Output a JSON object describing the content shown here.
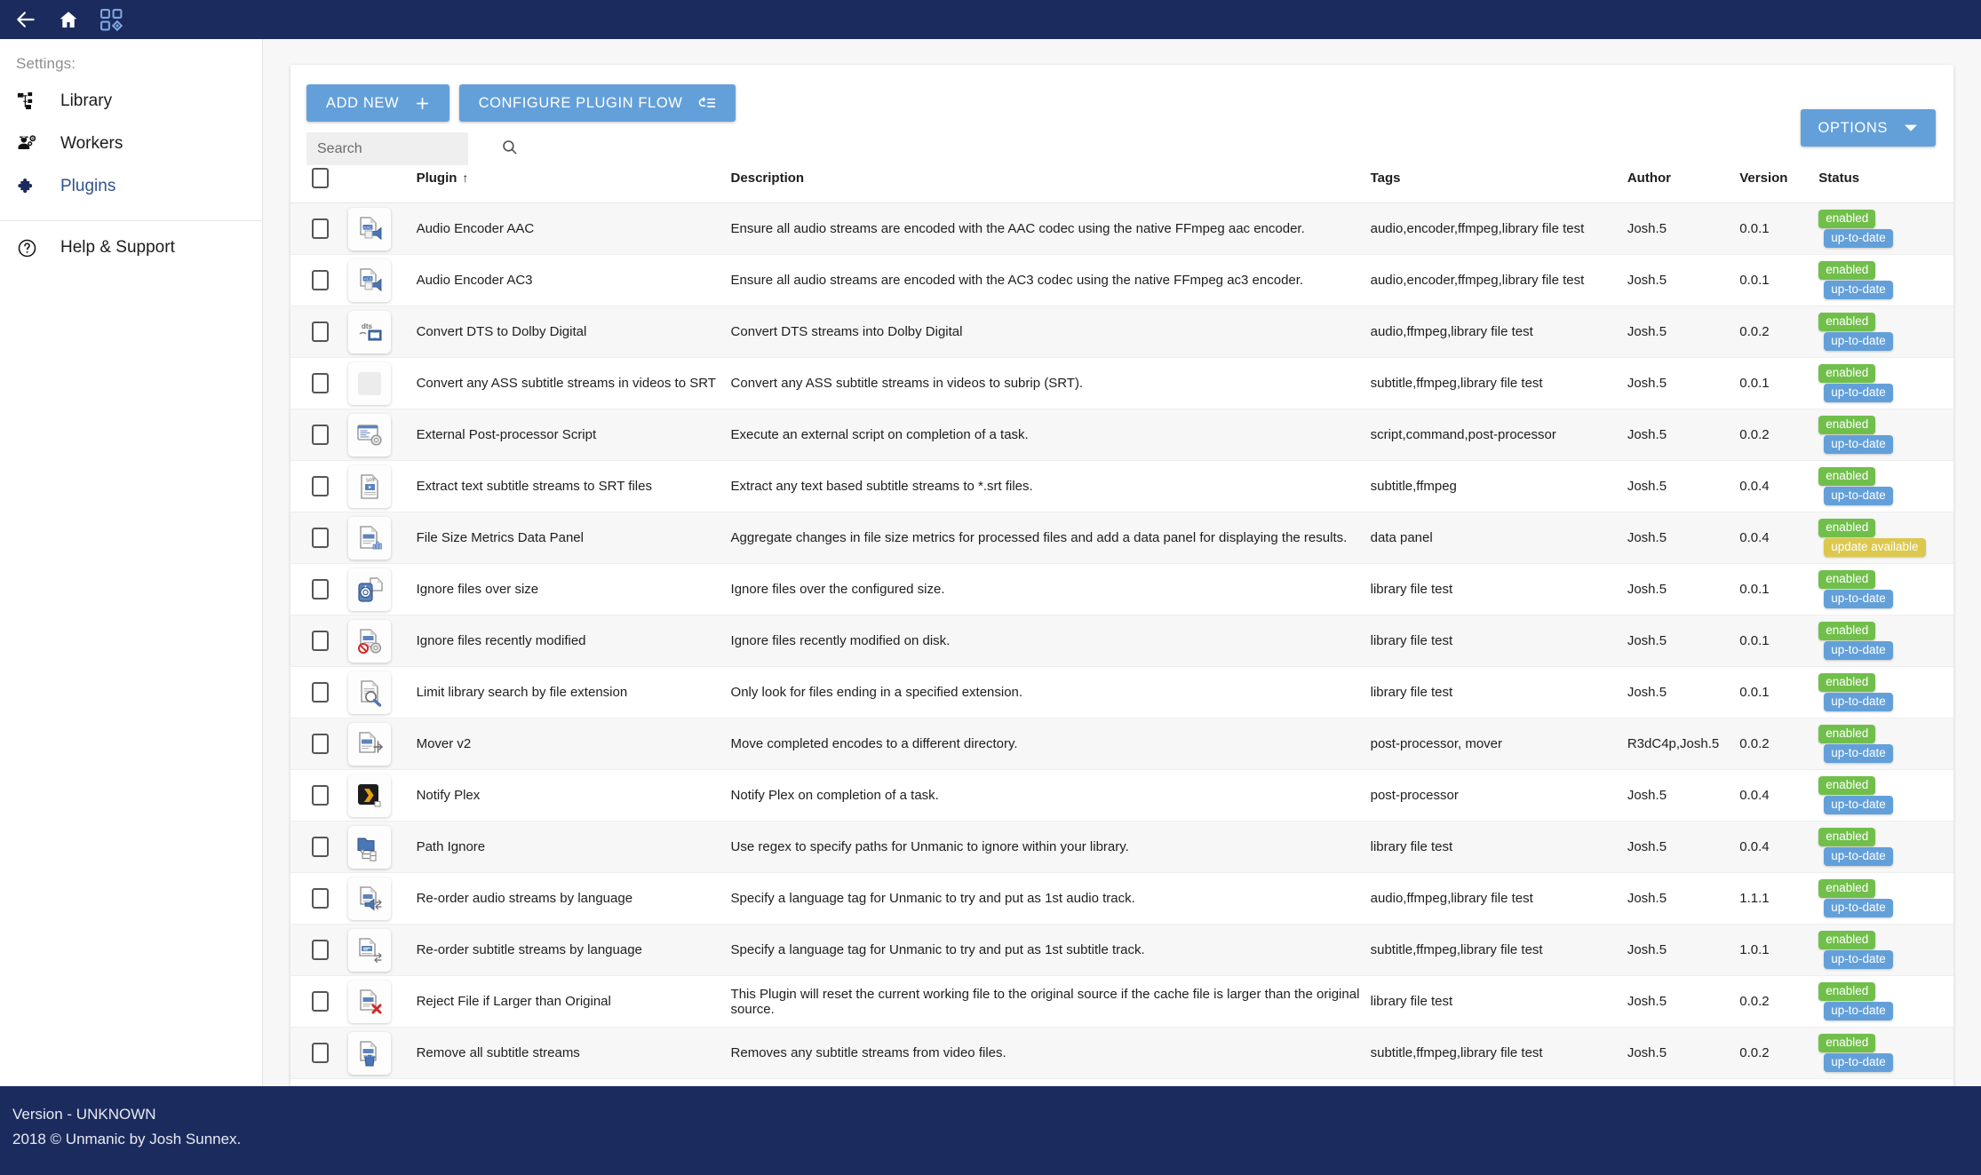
{
  "appbar": {
    "back_icon": "arrow-left-icon",
    "home_icon": "home-icon",
    "dashboard_icon": "dashboard-grid-icon"
  },
  "sidebar": {
    "heading": "Settings:",
    "items": [
      {
        "label": "Library",
        "icon": "sitemap-icon",
        "active": false
      },
      {
        "label": "Workers",
        "icon": "worker-icon",
        "active": false
      },
      {
        "label": "Plugins",
        "icon": "puzzle-icon",
        "active": true
      }
    ],
    "help": {
      "label": "Help & Support",
      "icon": "question-circle-icon"
    }
  },
  "toolbar": {
    "add_new_label": "ADD NEW",
    "add_new_icon": "plus-icon",
    "configure_flow_label": "CONFIGURE PLUGIN FLOW",
    "configure_flow_icon": "flow-icon",
    "options_label": "OPTIONS",
    "options_icon": "chevron-down-icon"
  },
  "search": {
    "value": "",
    "placeholder": "Search",
    "icon": "search-icon"
  },
  "table": {
    "columns": {
      "plugin": "Plugin",
      "description": "Description",
      "tags": "Tags",
      "author": "Author",
      "version": "Version",
      "status": "Status"
    },
    "sort_indicator": "↑",
    "rows": [
      {
        "name": "Audio Encoder AAC",
        "description": "Ensure all audio streams are encoded with the AAC codec using the native FFmpeg aac encoder.",
        "tags": "audio,encoder,ffmpeg,library file test",
        "author": "Josh.5",
        "version": "0.0.1",
        "status": [
          "enabled",
          "up-to-date"
        ],
        "icon": "audio-file-aac-icon"
      },
      {
        "name": "Audio Encoder AC3",
        "description": "Ensure all audio streams are encoded with the AC3 codec using the native FFmpeg ac3 encoder.",
        "tags": "audio,encoder,ffmpeg,library file test",
        "author": "Josh.5",
        "version": "0.0.1",
        "status": [
          "enabled",
          "up-to-date"
        ],
        "icon": "audio-file-ac3-icon"
      },
      {
        "name": "Convert DTS to Dolby Digital",
        "description": "Convert DTS streams into Dolby Digital",
        "tags": "audio,ffmpeg,library file test",
        "author": "Josh.5",
        "version": "0.0.2",
        "status": [
          "enabled",
          "up-to-date"
        ],
        "icon": "dts-dolby-icon"
      },
      {
        "name": "Convert any ASS subtitle streams in videos to SRT",
        "description": "Convert any ASS subtitle streams in videos to subrip (SRT).",
        "tags": "subtitle,ffmpeg,library file test",
        "author": "Josh.5",
        "version": "0.0.1",
        "status": [
          "enabled",
          "up-to-date"
        ],
        "icon": "blank-placeholder-icon"
      },
      {
        "name": "External Post-processor Script",
        "description": "Execute an external script on completion of a task.",
        "tags": "script,command,post-processor",
        "author": "Josh.5",
        "version": "0.0.2",
        "status": [
          "enabled",
          "up-to-date"
        ],
        "icon": "script-gear-icon"
      },
      {
        "name": "Extract text subtitle streams to SRT files",
        "description": "Extract any text based subtitle streams to *.srt files.",
        "tags": "subtitle,ffmpeg",
        "author": "Josh.5",
        "version": "0.0.4",
        "status": [
          "enabled",
          "up-to-date"
        ],
        "icon": "srt-document-icon"
      },
      {
        "name": "File Size Metrics Data Panel",
        "description": "Aggregate changes in file size metrics for processed files and add a data panel for displaying the results.",
        "tags": "data panel",
        "author": "Josh.5",
        "version": "0.0.4",
        "status": [
          "enabled",
          "update available"
        ],
        "icon": "file-chart-icon"
      },
      {
        "name": "Ignore files over size",
        "description": "Ignore files over the configured size.",
        "tags": "library file test",
        "author": "Josh.5",
        "version": "0.0.1",
        "status": [
          "enabled",
          "up-to-date"
        ],
        "icon": "file-scale-icon"
      },
      {
        "name": "Ignore files recently modified",
        "description": "Ignore files recently modified on disk.",
        "tags": "library file test",
        "author": "Josh.5",
        "version": "0.0.1",
        "status": [
          "enabled",
          "up-to-date"
        ],
        "icon": "file-block-gear-icon"
      },
      {
        "name": "Limit library search by file extension",
        "description": "Only look for files ending in a specified extension.",
        "tags": "library file test",
        "author": "Josh.5",
        "version": "0.0.1",
        "status": [
          "enabled",
          "up-to-date"
        ],
        "icon": "file-magnifier-icon"
      },
      {
        "name": "Mover v2",
        "description": "Move completed encodes to a different directory.",
        "tags": "post-processor, mover",
        "author": "R3dC4p,Josh.5",
        "version": "0.0.2",
        "status": [
          "enabled",
          "up-to-date"
        ],
        "icon": "file-move-icon"
      },
      {
        "name": "Notify Plex",
        "description": "Notify Plex on completion of a task.",
        "tags": "post-processor",
        "author": "Josh.5",
        "version": "0.0.4",
        "status": [
          "enabled",
          "up-to-date"
        ],
        "icon": "plex-icon"
      },
      {
        "name": "Path Ignore",
        "description": "Use regex to specify paths for Unmanic to ignore within your library.",
        "tags": "library file test",
        "author": "Josh.5",
        "version": "0.0.4",
        "status": [
          "enabled",
          "up-to-date"
        ],
        "icon": "folder-tree-icon"
      },
      {
        "name": "Re-order audio streams by language",
        "description": "Specify a language tag for Unmanic to try and put as 1st audio track.",
        "tags": "audio,ffmpeg,library file test",
        "author": "Josh.5",
        "version": "1.1.1",
        "status": [
          "enabled",
          "up-to-date"
        ],
        "icon": "audio-reorder-icon"
      },
      {
        "name": "Re-order subtitle streams by language",
        "description": "Specify a language tag for Unmanic to try and put as 1st subtitle track.",
        "tags": "subtitle,ffmpeg,library file test",
        "author": "Josh.5",
        "version": "1.0.1",
        "status": [
          "enabled",
          "up-to-date"
        ],
        "icon": "subtitle-reorder-icon"
      },
      {
        "name": "Reject File if Larger than Original",
        "description": "This Plugin will reset the current working file to the original source if the cache file is larger than the original source.",
        "tags": "library file test",
        "author": "Josh.5",
        "version": "0.0.2",
        "status": [
          "enabled",
          "up-to-date"
        ],
        "icon": "file-reject-icon"
      },
      {
        "name": "Remove all subtitle streams",
        "description": "Removes any subtitle streams from video files.",
        "tags": "subtitle,ffmpeg,library file test",
        "author": "Josh.5",
        "version": "0.0.2",
        "status": [
          "enabled",
          "up-to-date"
        ],
        "icon": "file-delete-icon"
      }
    ]
  },
  "footer": {
    "version_line": "Version - UNKNOWN",
    "copyright_line": "2018 © Unmanic by Josh Sunnex."
  },
  "colors": {
    "brand_navy": "#1b2b5e",
    "accent_blue": "#63a0da",
    "badge_green": "#71bf4b",
    "badge_yellow": "#ddc84e",
    "active_nav": "#31518f"
  }
}
